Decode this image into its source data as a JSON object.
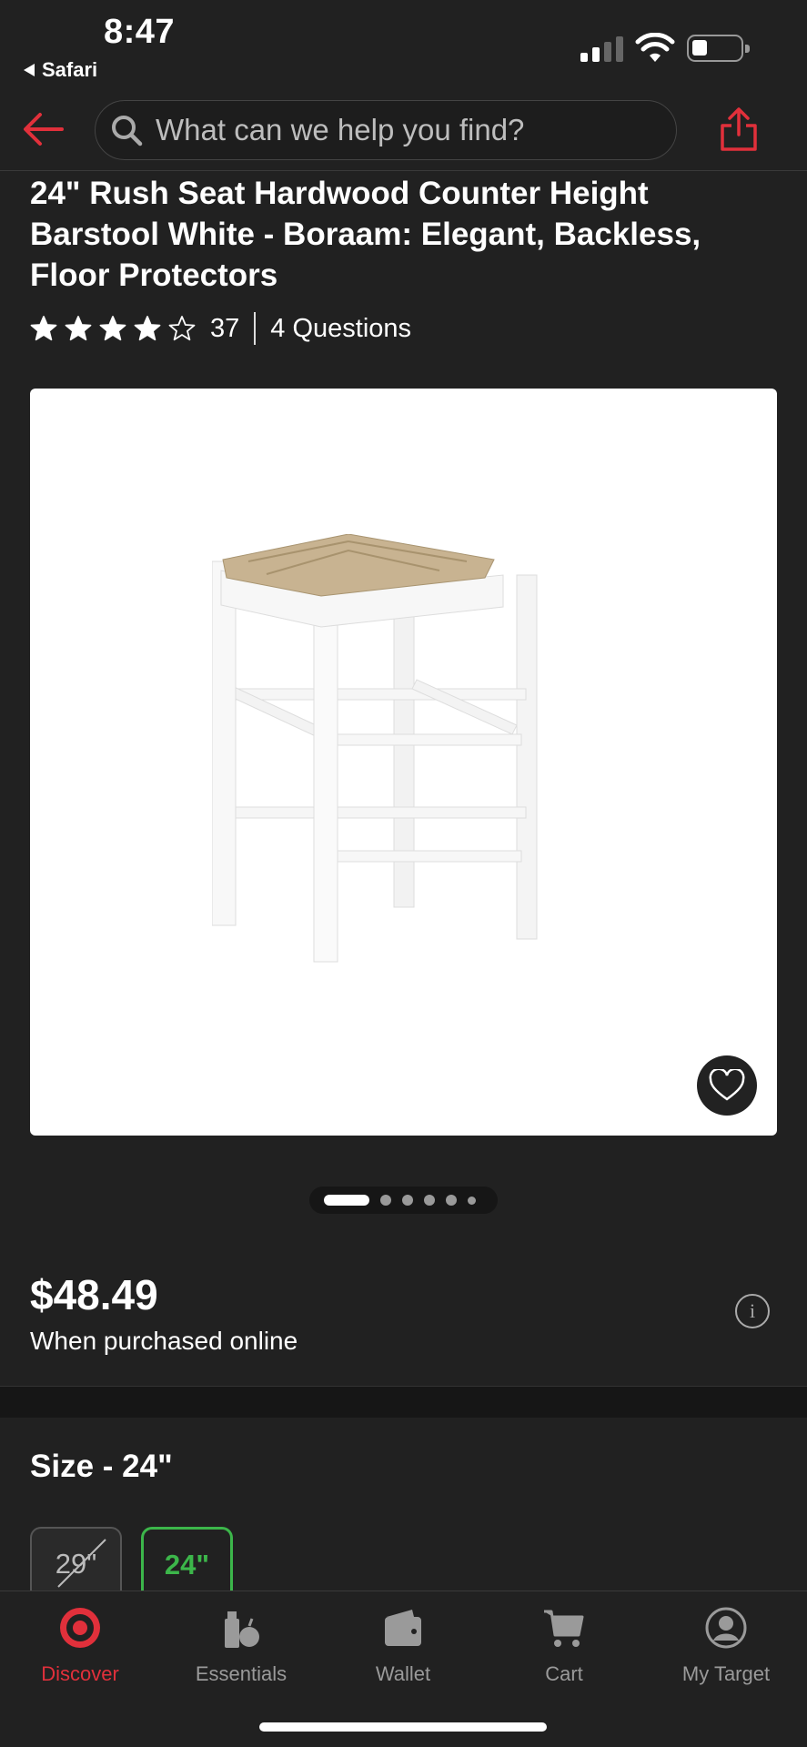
{
  "status_bar": {
    "time": "8:47",
    "back_app": "Safari"
  },
  "header": {
    "search_placeholder": "What can we help you find?"
  },
  "product": {
    "title": "24\" Rush Seat Hardwood Counter Height Barstool White - Boraam: Elegant, Backless, Floor Protectors",
    "rating": 4,
    "rating_max": 5,
    "rating_count": "37",
    "questions": "4 Questions",
    "image_count": 6,
    "image_index": 1,
    "price": "$48.49",
    "price_note": "When purchased online",
    "size_label": "Size - 24\"",
    "sizes": [
      {
        "label": "29\"",
        "state": "unavailable"
      },
      {
        "label": "24\"",
        "state": "selected"
      }
    ]
  },
  "tabs": [
    {
      "label": "Discover",
      "icon": "target-logo-icon",
      "active": true
    },
    {
      "label": "Essentials",
      "icon": "essentials-icon",
      "active": false
    },
    {
      "label": "Wallet",
      "icon": "wallet-icon",
      "active": false
    },
    {
      "label": "Cart",
      "icon": "cart-icon",
      "active": false
    },
    {
      "label": "My Target",
      "icon": "account-icon",
      "active": false
    }
  ],
  "colors": {
    "accent": "#e1303b",
    "selected": "#3cb64a",
    "background": "#212121"
  }
}
